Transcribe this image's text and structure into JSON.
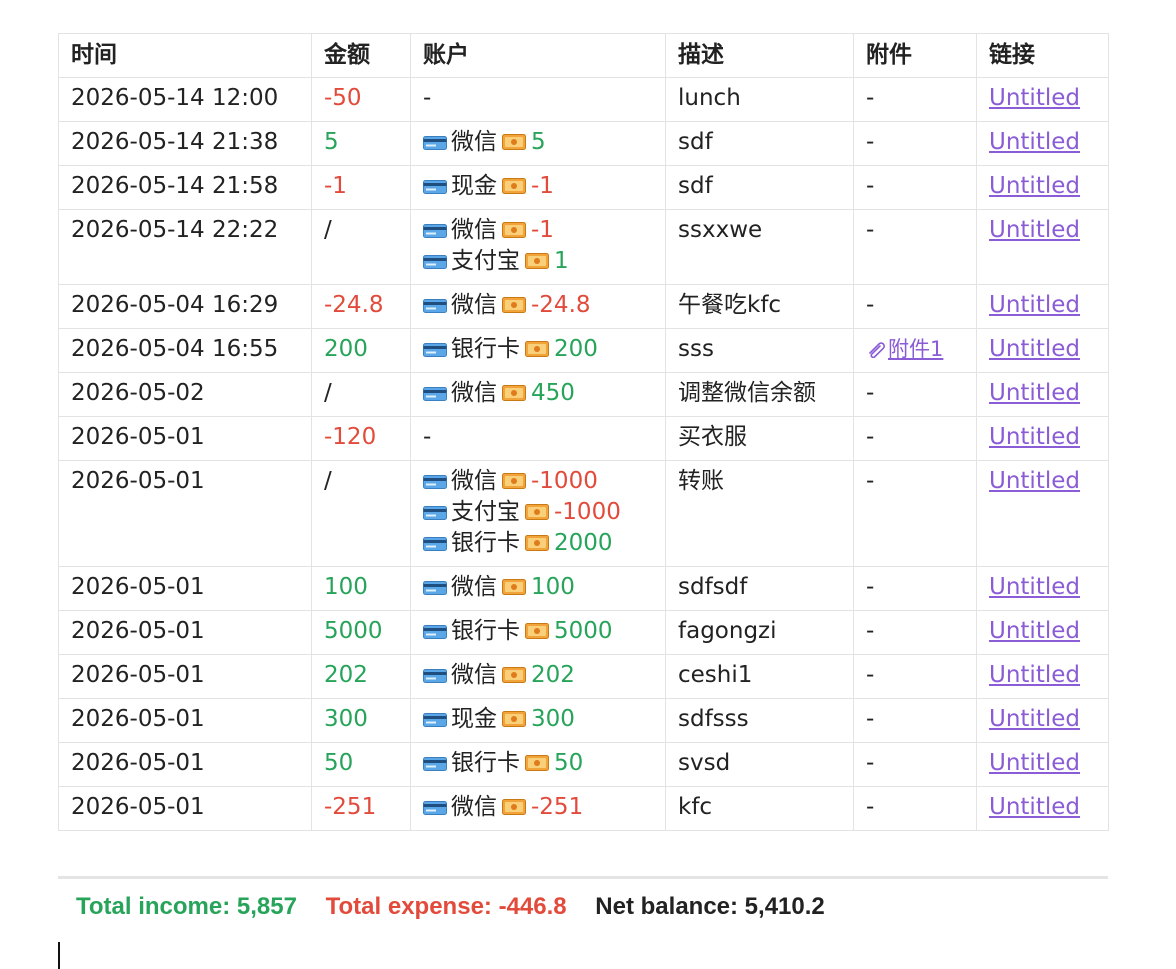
{
  "table": {
    "headers": {
      "time": "时间",
      "amount": "金额",
      "account": "账户",
      "description": "描述",
      "attachment": "附件",
      "link": "链接"
    },
    "rows": [
      {
        "time": "2026-05-14 12:00",
        "amount": "-50",
        "amount_type": "expense",
        "accounts": [],
        "account_placeholder": "-",
        "description": "lunch",
        "attachment": "-",
        "link": "Untitled"
      },
      {
        "time": "2026-05-14 21:38",
        "amount": "5",
        "amount_type": "income",
        "accounts": [
          {
            "name": "微信",
            "value": "5",
            "type": "income"
          }
        ],
        "description": "sdf",
        "attachment": "-",
        "link": "Untitled"
      },
      {
        "time": "2026-05-14 21:58",
        "amount": "-1",
        "amount_type": "expense",
        "accounts": [
          {
            "name": "现金",
            "value": "-1",
            "type": "expense"
          }
        ],
        "description": "sdf",
        "attachment": "-",
        "link": "Untitled"
      },
      {
        "time": "2026-05-14 22:22",
        "amount": "/",
        "amount_type": "neutral",
        "accounts": [
          {
            "name": "微信",
            "value": "-1",
            "type": "expense"
          },
          {
            "name": "支付宝",
            "value": "1",
            "type": "income"
          }
        ],
        "description": "ssxxwe",
        "attachment": "-",
        "link": "Untitled"
      },
      {
        "time": "2026-05-04 16:29",
        "amount": "-24.8",
        "amount_type": "expense",
        "accounts": [
          {
            "name": "微信",
            "value": "-24.8",
            "type": "expense"
          }
        ],
        "description": "午餐吃kfc",
        "attachment": "-",
        "link": "Untitled"
      },
      {
        "time": "2026-05-04 16:55",
        "amount": "200",
        "amount_type": "income",
        "accounts": [
          {
            "name": "银行卡",
            "value": "200",
            "type": "income"
          }
        ],
        "description": "sss",
        "attachment": "附件1",
        "attachment_is_link": true,
        "link": "Untitled"
      },
      {
        "time": "2026-05-02",
        "amount": "/",
        "amount_type": "neutral",
        "accounts": [
          {
            "name": "微信",
            "value": "450",
            "type": "income"
          }
        ],
        "description": "调整微信余额",
        "attachment": "-",
        "link": "Untitled"
      },
      {
        "time": "2026-05-01",
        "amount": "-120",
        "amount_type": "expense",
        "accounts": [],
        "account_placeholder": "-",
        "description": "买衣服",
        "attachment": "-",
        "link": "Untitled"
      },
      {
        "time": "2026-05-01",
        "amount": "/",
        "amount_type": "neutral",
        "accounts": [
          {
            "name": "微信",
            "value": "-1000",
            "type": "expense"
          },
          {
            "name": "支付宝",
            "value": "-1000",
            "type": "expense"
          },
          {
            "name": "银行卡",
            "value": "2000",
            "type": "income"
          }
        ],
        "description": "转账",
        "attachment": "-",
        "link": "Untitled"
      },
      {
        "time": "2026-05-01",
        "amount": "100",
        "amount_type": "income",
        "accounts": [
          {
            "name": "微信",
            "value": "100",
            "type": "income"
          }
        ],
        "description": "sdfsdf",
        "attachment": "-",
        "link": "Untitled"
      },
      {
        "time": "2026-05-01",
        "amount": "5000",
        "amount_type": "income",
        "accounts": [
          {
            "name": "银行卡",
            "value": "5000",
            "type": "income"
          }
        ],
        "description": "fagongzi",
        "attachment": "-",
        "link": "Untitled"
      },
      {
        "time": "2026-05-01",
        "amount": "202",
        "amount_type": "income",
        "accounts": [
          {
            "name": "微信",
            "value": "202",
            "type": "income"
          }
        ],
        "description": "ceshi1",
        "attachment": "-",
        "link": "Untitled"
      },
      {
        "time": "2026-05-01",
        "amount": "300",
        "amount_type": "income",
        "accounts": [
          {
            "name": "现金",
            "value": "300",
            "type": "income"
          }
        ],
        "description": "sdfsss",
        "attachment": "-",
        "link": "Untitled"
      },
      {
        "time": "2026-05-01",
        "amount": "50",
        "amount_type": "income",
        "accounts": [
          {
            "name": "银行卡",
            "value": "50",
            "type": "income"
          }
        ],
        "description": "svsd",
        "attachment": "-",
        "link": "Untitled"
      },
      {
        "time": "2026-05-01",
        "amount": "-251",
        "amount_type": "expense",
        "accounts": [
          {
            "name": "微信",
            "value": "-251",
            "type": "expense"
          }
        ],
        "description": "kfc",
        "attachment": "-",
        "link": "Untitled"
      }
    ]
  },
  "icons": {
    "account": "credit-card-icon",
    "amount": "money-icon",
    "attachment": "paperclip-icon"
  },
  "summary": {
    "income_label": "Total income: 5,857",
    "expense_label": "Total expense: -446.8",
    "net_label": "Net balance: 5,410.2"
  },
  "colors": {
    "income": "#27a45a",
    "expense": "#e24b3b",
    "link": "#8a5cd6",
    "text": "#222222"
  }
}
